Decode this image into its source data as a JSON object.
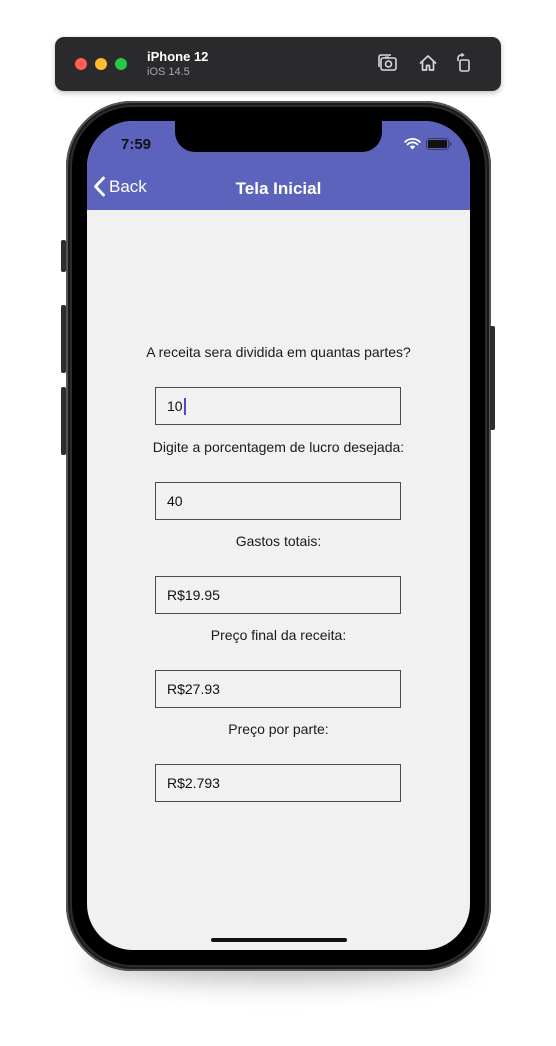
{
  "simulator": {
    "device_name": "iPhone 12",
    "os_version": "iOS 14.5",
    "traffic_lights": {
      "close": "#fe5f57",
      "minimize": "#febc2e",
      "zoom": "#28c840"
    },
    "buttons": {
      "screenshot": "screenshot-icon",
      "home": "home-icon",
      "rotate": "rotate-icon"
    }
  },
  "status_bar": {
    "time": "7:59",
    "icons": [
      "wifi-icon",
      "battery-icon"
    ]
  },
  "nav_bar": {
    "background": "#5b63bc",
    "back_label": "Back",
    "title": "Tela Inicial"
  },
  "form": {
    "parts_label": "A receita sera dividida em quantas partes?",
    "parts_value": "10",
    "profit_label": "Digite a porcentagem de lucro desejada:",
    "profit_value": "40",
    "total_cost_label": "Gastos totais:",
    "total_cost_value": "R$19.95",
    "final_price_label": "Preço final da receita:",
    "final_price_value": "R$27.93",
    "price_per_part_label": "Preço por parte:",
    "price_per_part_value": "R$2.793"
  }
}
